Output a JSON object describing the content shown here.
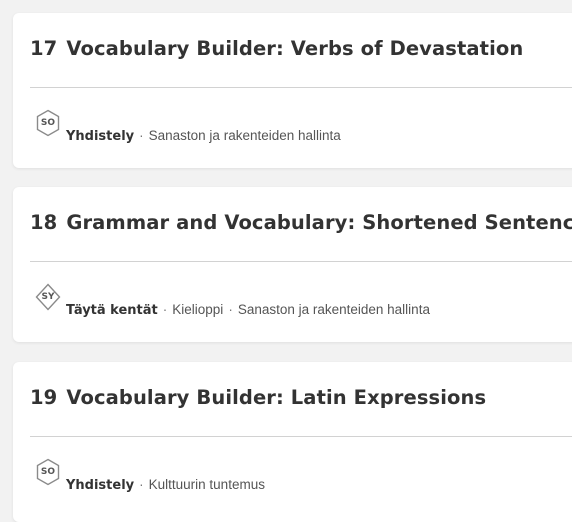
{
  "items": [
    {
      "number": "17",
      "title": "Vocabulary Builder: Verbs of Devastation",
      "badge": "SO",
      "badge_shape": "hexagon",
      "type": "Yhdistely",
      "tags": [
        "Sanaston ja rakenteiden hallinta"
      ]
    },
    {
      "number": "18",
      "title": "Grammar and Vocabulary: Shortened Sentences",
      "badge": "SY",
      "badge_shape": "diamond",
      "type": "Täytä kentät",
      "tags": [
        "Kielioppi",
        "Sanaston ja rakenteiden hallinta"
      ]
    },
    {
      "number": "19",
      "title": "Vocabulary Builder: Latin Expressions",
      "badge": "SO",
      "badge_shape": "hexagon",
      "type": "Yhdistely",
      "tags": [
        "Kulttuurin tuntemus"
      ]
    }
  ],
  "separator": "·",
  "colors": {
    "background": "#f2f2f2",
    "card": "#ffffff",
    "title": "#333333",
    "meta": "#555555",
    "divider": "#d2d2d2"
  }
}
